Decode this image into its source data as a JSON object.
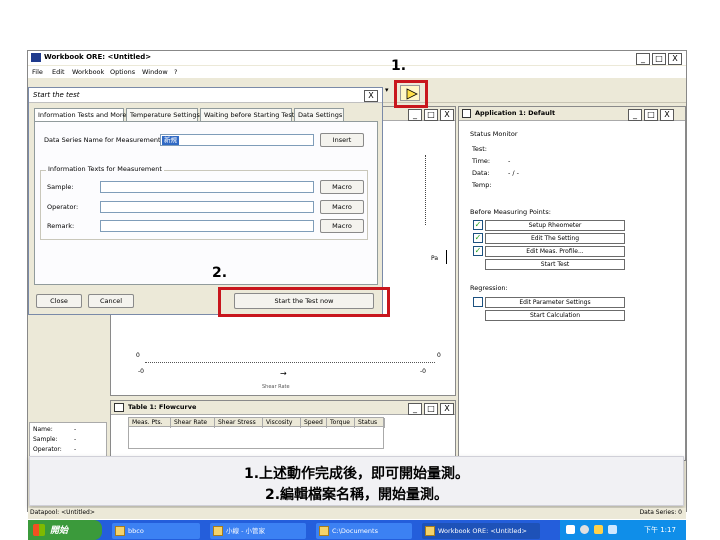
{
  "workbook": {
    "title": "Workbook ORE: <Untitled>",
    "menu": [
      "File",
      "Edit",
      "Workbook",
      "Options",
      "Window",
      "?"
    ],
    "win_buttons": [
      "_",
      "□",
      "X"
    ]
  },
  "dialog": {
    "title": "Start the test",
    "close": "X",
    "tabs": [
      "Information Tests and More",
      "Temperature Settings",
      "Waiting before Starting Test",
      "Data Settings"
    ],
    "file_name_label": "Data Series Name for Measurement:",
    "file_name_value": "新規",
    "insert_button": "Insert",
    "info_group_title": "Information Texts for Measurement",
    "fields": [
      {
        "label": "Sample:",
        "button": "Macro"
      },
      {
        "label": "Operator:",
        "button": "Macro"
      },
      {
        "label": "Remark:",
        "button": "Macro"
      }
    ],
    "close_button": "Close",
    "cancel_button": "Cancel",
    "start_button": "Start the Test now"
  },
  "chart_window": {
    "axis_left_top": "0",
    "axis_left_bottom": "-0",
    "axis_right_top": "0",
    "axis_right_bottom": "-0",
    "x_caption": "Shear Rate",
    "pa_label": "Pa"
  },
  "table_window": {
    "title": "Table 1: Flowcurve",
    "columns": [
      "Meas. Pts.",
      "Shear Rate",
      "Shear Stress",
      "Viscosity",
      "Speed",
      "Torque",
      "Status"
    ]
  },
  "left_info": {
    "rows": [
      {
        "label": "Name:",
        "value": "-"
      },
      {
        "label": "Sample:",
        "value": "-"
      },
      {
        "label": "Operator:",
        "value": "-"
      }
    ]
  },
  "app_window": {
    "title": "Application 1: Default",
    "status_monitor": "Status Monitor",
    "status_rows": [
      {
        "label": "Test:",
        "value": ""
      },
      {
        "label": "Time:",
        "value": "-"
      },
      {
        "label": "Data:",
        "value": "- / -"
      },
      {
        "label": "Temp:",
        "value": ""
      }
    ],
    "before_title": "Before Measuring Points:",
    "before_items": [
      {
        "checked": true,
        "label": "Setup Rheometer"
      },
      {
        "checked": true,
        "label": "Edit The Setting"
      },
      {
        "checked": true,
        "label": "Edit Meas. Profile..."
      }
    ],
    "start_test": "Start Test",
    "regression_title": "Regression:",
    "regression_items": [
      {
        "checked": false,
        "label": "Edit Parameter Settings"
      }
    ],
    "start_calc": "Start Calculation"
  },
  "annotations": {
    "step1": "1.",
    "step2": "2.",
    "caption_line1": "1.上述動作完成後，即可開始量測。",
    "caption_line2": "2.編輯檔案名稱，開始量測。"
  },
  "statusbar": {
    "left": "Datapool: <Untitled>",
    "right": "Data Series: 0"
  },
  "taskbar": {
    "start": "開始",
    "items": [
      {
        "label": "bbco"
      },
      {
        "label": "小線 - 小管家"
      },
      {
        "label": "C:\\Documents"
      },
      {
        "label": "Workbook ORE: <Untitled>",
        "active": true
      }
    ],
    "time": "下午 1:17"
  },
  "colors": {
    "red_box": "#c8161d",
    "title_blue": "#0a246a",
    "taskbar": "#245edb",
    "start_green": "#3b9a3b"
  }
}
